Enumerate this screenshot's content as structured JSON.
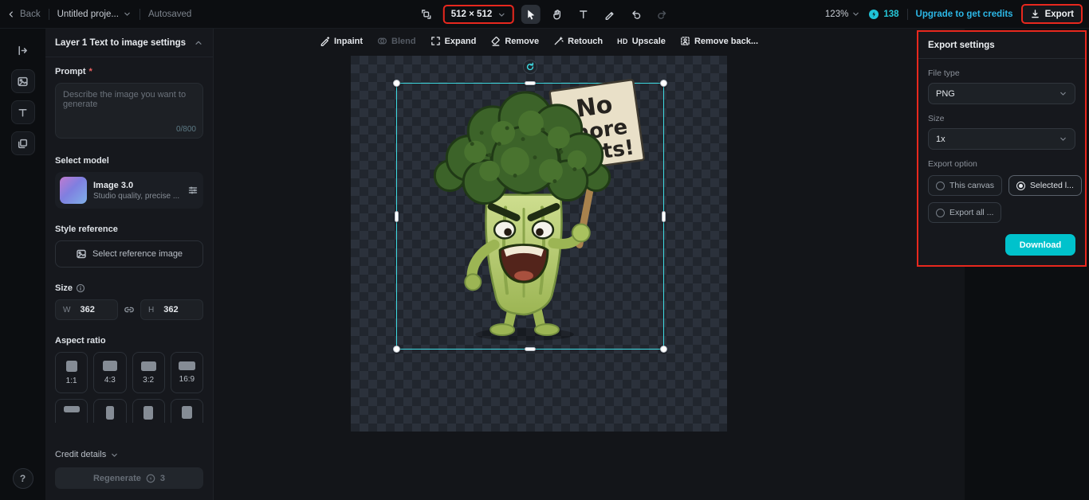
{
  "topbar": {
    "back_label": "Back",
    "project_name": "Untitled proje...",
    "autosaved_label": "Autosaved",
    "canvas_size_value": "512 × 512",
    "zoom_value": "123%",
    "credits_count": "138",
    "upgrade_label": "Upgrade to get credits",
    "export_label": "Export"
  },
  "left_panel": {
    "header_title": "Layer 1 Text to image settings",
    "prompt": {
      "label": "Prompt",
      "required_mark": "*",
      "placeholder": "Describe the image you want to generate",
      "counter": "0/800"
    },
    "select_model_label": "Select model",
    "model": {
      "name": "Image 3.0",
      "description": "Studio quality, precise ..."
    },
    "style_reference_label": "Style reference",
    "style_reference_button": "Select reference image",
    "size_label": "Size",
    "width": {
      "prefix": "W",
      "value": "362"
    },
    "height": {
      "prefix": "H",
      "value": "362"
    },
    "aspect_ratio_label": "Aspect ratio",
    "ratios": [
      "1:1",
      "4:3",
      "3:2",
      "16:9"
    ],
    "credit_details_label": "Credit details",
    "regenerate_label": "Regenerate",
    "regenerate_cost": "3"
  },
  "canvas": {
    "tools": [
      {
        "label": "Inpaint"
      },
      {
        "label": "Blend"
      },
      {
        "label": "Expand"
      },
      {
        "label": "Remove"
      },
      {
        "label": "Retouch"
      },
      {
        "label": "Upscale",
        "badge": "HD"
      },
      {
        "label": "Remove back..."
      }
    ],
    "sign_lines": [
      "No",
      "more",
      "diets!"
    ]
  },
  "export_panel": {
    "title": "Export settings",
    "file_type_label": "File type",
    "file_type_value": "PNG",
    "size_label": "Size",
    "size_value": "1x",
    "export_option_label": "Export option",
    "options": [
      {
        "label": "This canvas",
        "selected": false
      },
      {
        "label": "Selected l...",
        "selected": true
      },
      {
        "label": "Export all ...",
        "selected": false
      }
    ],
    "download_label": "Download"
  },
  "colors": {
    "accent_cyan": "#00c2cc",
    "selection_cyan": "#3fdbe3",
    "annotation_red": "#e8281e",
    "link_blue": "#2cb7e6"
  }
}
